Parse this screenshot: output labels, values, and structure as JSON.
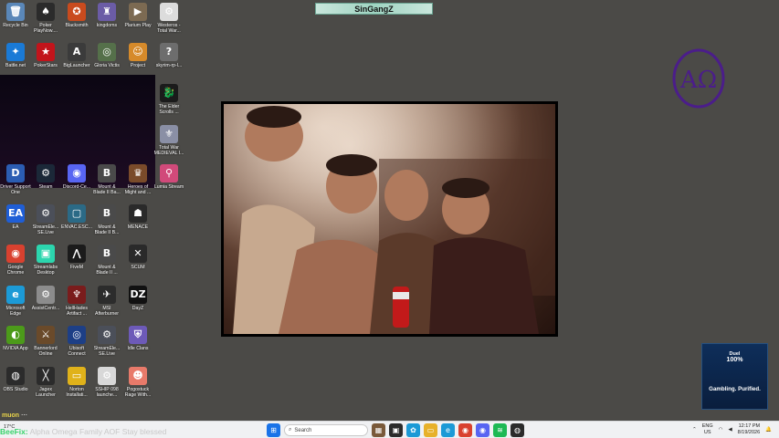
{
  "window_title": "SinGangZ",
  "desktop_icons": [
    {
      "label": "Recycle Bin",
      "color": "#5a87b8",
      "glyph": "🗑"
    },
    {
      "label": "Poker PlayNow....",
      "color": "#2b2b2b",
      "glyph": "♠"
    },
    {
      "label": "Blacksmith",
      "color": "#c94b1e",
      "glyph": "✪"
    },
    {
      "label": "kingdoms",
      "color": "#6b5ca6",
      "glyph": "♜"
    },
    {
      "label": "Plarium Play",
      "color": "#7c6a52",
      "glyph": "▶"
    },
    {
      "label": "Westeros - Total War...",
      "color": "#dcdcdc",
      "glyph": "⚙"
    },
    {
      "label": "Battle.net",
      "color": "#1a7ad6",
      "glyph": "✦"
    },
    {
      "label": "PokerStars",
      "color": "#c2141b",
      "glyph": "★"
    },
    {
      "label": "BigLauncher",
      "color": "#3b3b3b",
      "glyph": "A"
    },
    {
      "label": "Gloria Victis",
      "color": "#55704a",
      "glyph": "◎"
    },
    {
      "label": "Project",
      "color": "#d68a2a",
      "glyph": "☺"
    },
    {
      "label": "skyrim-rp-l...",
      "color": "#6d6d6d",
      "glyph": "?"
    },
    {
      "label": "The Elder Scrolls ...",
      "color": "#1b1b1b",
      "glyph": "🐉"
    },
    {
      "label": "Total War MEDIEVAL I...",
      "color": "#8a8fa5",
      "glyph": "⚜"
    },
    {
      "label": "Lumia Stream",
      "color": "#d14a7a",
      "glyph": "⚲"
    },
    {
      "label": "Driver Support One",
      "color": "#2b5db2",
      "glyph": "D"
    },
    {
      "label": "Steam",
      "color": "#1b2838",
      "glyph": "⚙"
    },
    {
      "label": "Discord-Ce...",
      "color": "#5865f2",
      "glyph": "◉"
    },
    {
      "label": "Mount & Blade II Ba...",
      "color": "#4a4a4a",
      "glyph": "B"
    },
    {
      "label": "Heroes of Might and ...",
      "color": "#7a4b2a",
      "glyph": "♛"
    },
    {
      "label": "EA",
      "color": "#1f5ed6",
      "glyph": "EA"
    },
    {
      "label": "StreamEle... SE.Live",
      "color": "#4b4f59",
      "glyph": "⚙"
    },
    {
      "label": "ENVAC.ESC...",
      "color": "#2b6a86",
      "glyph": "▢"
    },
    {
      "label": "Mount & Blade II B...",
      "color": "#4a4a4a",
      "glyph": "B"
    },
    {
      "label": "MENACE",
      "color": "#2a2a2a",
      "glyph": "☗"
    },
    {
      "label": "Google Chrome",
      "color": "#d9412f",
      "glyph": "◉"
    },
    {
      "label": "Streamlabs Desktop",
      "color": "#2cd6ae",
      "glyph": "▣"
    },
    {
      "label": "FiveM",
      "color": "#1b1b1b",
      "glyph": "⋀"
    },
    {
      "label": "Mount & Blade II ...",
      "color": "#4a4a4a",
      "glyph": "B"
    },
    {
      "label": "SCUM",
      "color": "#2a2a2a",
      "glyph": "✕"
    },
    {
      "label": "Microsoft Edge",
      "color": "#1c9ad6",
      "glyph": "e"
    },
    {
      "label": "AssistCentr...",
      "color": "#8c8c8c",
      "glyph": "⚙"
    },
    {
      "label": "HellHades Artifact ...",
      "color": "#7a1c1c",
      "glyph": "♆"
    },
    {
      "label": "MSI Afterburner",
      "color": "#2c2c2c",
      "glyph": "✈"
    },
    {
      "label": "DayZ",
      "color": "#111111",
      "glyph": "DZ"
    },
    {
      "label": "NVIDIA App",
      "color": "#4c9a1a",
      "glyph": "◐"
    },
    {
      "label": "Bannerlord Online",
      "color": "#6a4a2a",
      "glyph": "⚔"
    },
    {
      "label": "Ubisoft Connect",
      "color": "#1d3f86",
      "glyph": "◎"
    },
    {
      "label": "StreamEle... SE.Live",
      "color": "#4b4f59",
      "glyph": "⚙"
    },
    {
      "label": "Idle Clans",
      "color": "#6d5ab8",
      "glyph": "⛨"
    },
    {
      "label": "OBS Studio",
      "color": "#2b2b2b",
      "glyph": "◍"
    },
    {
      "label": "Jagex Launcher",
      "color": "#2b2b2b",
      "glyph": "╳"
    },
    {
      "label": "Norton Installati...",
      "color": "#e0b21a",
      "glyph": "▭"
    },
    {
      "label": "SSHIP 098 launche...",
      "color": "#d8d8d8",
      "glyph": "⚙"
    },
    {
      "label": "Pogostuck Rage With...",
      "color": "#e87a6a",
      "glyph": "☻"
    }
  ],
  "logo_text": "AΩ",
  "ad": {
    "line1": "Duel",
    "line2": "100%",
    "line3": "Gambling. Purified."
  },
  "overlay": {
    "user": "muon",
    "status": "⋯"
  },
  "chat": {
    "user": "BeeFix:",
    "message": "Alpha Omega Family AOF Stay blessed"
  },
  "taskbar": {
    "weather": "17°C",
    "search_placeholder": "Search",
    "lang": "ENG",
    "region": "US",
    "time": "12:17 PM",
    "date": "8/19/2026"
  },
  "colors": {
    "logo": "#4b1d8a",
    "banner": "#9fd3c1"
  }
}
